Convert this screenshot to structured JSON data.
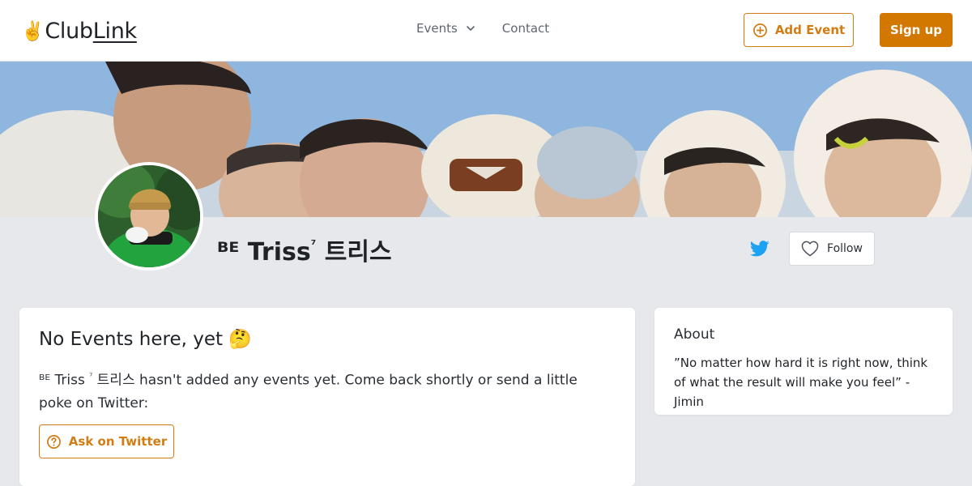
{
  "header": {
    "logo_emoji": "✌️",
    "logo_text_main": "Club",
    "logo_text_link": "Link",
    "nav": {
      "events_label": "Events",
      "contact_label": "Contact"
    },
    "add_event_label": "Add Event",
    "signup_label": "Sign up"
  },
  "profile": {
    "name_prefix": "ᴮᴱ",
    "name_main": "Triss",
    "name_sup": "⁷",
    "name_korean": "트리스",
    "follow_label": "Follow"
  },
  "events": {
    "title": "No Events here, yet 🤔",
    "message_prefix": "ᴮᴱ",
    "message_name": "Triss",
    "message_sup": "⁷",
    "message_korean": "트리스",
    "message_body": "hasn't added any events yet. Come back shortly or send a little poke on Twitter:",
    "ask_button_label": "Ask on Twitter"
  },
  "about": {
    "title": "About",
    "text": "”No matter how hard it is right now, think of what the result will make you feel” - Jimin"
  },
  "colors": {
    "accent": "#d27c14",
    "accent_solid": "#d27700",
    "twitter": "#1da1f2",
    "page_background": "#e6e8ec"
  },
  "icons": {
    "logo": "victory-hand-icon",
    "events_dropdown": "chevron-down-icon",
    "add_event": "plus-circle-icon",
    "twitter": "twitter-bird-icon",
    "follow": "heart-outline-icon",
    "ask": "question-circle-icon"
  }
}
